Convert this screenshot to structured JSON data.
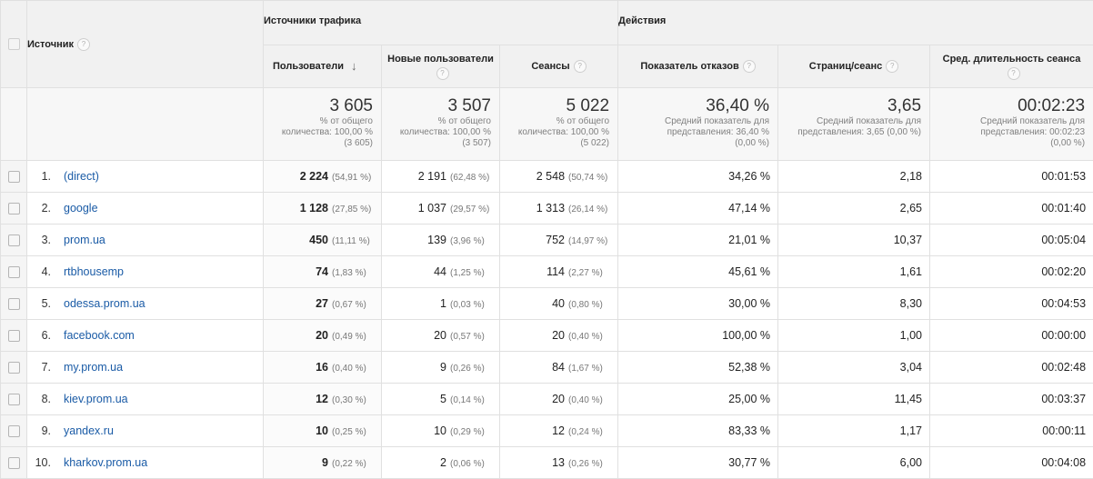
{
  "header": {
    "source_label": "Источник",
    "group_traffic": "Источники трафика",
    "group_actions": "Действия",
    "col_users": "Пользователи",
    "col_new_users": "Новые пользователи",
    "col_sessions": "Сеансы",
    "col_bounce": "Показатель отказов",
    "col_pages": "Страниц/сеанс",
    "col_duration": "Сред. длительность сеанса",
    "help_glyph": "?",
    "sort_glyph": "↓"
  },
  "totals": {
    "users": {
      "value": "3 605",
      "l1": "% от общего",
      "l2": "количества: 100,00 %",
      "l3": "(3 605)"
    },
    "new_users": {
      "value": "3 507",
      "l1": "% от общего",
      "l2": "количества: 100,00 %",
      "l3": "(3 507)"
    },
    "sessions": {
      "value": "5 022",
      "l1": "% от общего",
      "l2": "количества: 100,00 %",
      "l3": "(5 022)"
    },
    "bounce": {
      "value": "36,40 %",
      "l1": "Средний показатель для",
      "l2": "представления: 36,40 %",
      "l3": "(0,00 %)"
    },
    "pages": {
      "value": "3,65",
      "l1": "Средний показатель для",
      "l2": "представления: 3,65 (0,00 %)",
      "l3": ""
    },
    "duration": {
      "value": "00:02:23",
      "l1": "Средний показатель для",
      "l2": "представления: 00:02:23",
      "l3": "(0,00 %)"
    }
  },
  "rows": [
    {
      "idx": "1.",
      "source": "(direct)",
      "users": "2 224",
      "users_pct": "(54,91 %)",
      "new_users": "2 191",
      "new_users_pct": "(62,48 %)",
      "sessions": "2 548",
      "sessions_pct": "(50,74 %)",
      "bounce": "34,26 %",
      "pages": "2,18",
      "duration": "00:01:53"
    },
    {
      "idx": "2.",
      "source": "google",
      "users": "1 128",
      "users_pct": "(27,85 %)",
      "new_users": "1 037",
      "new_users_pct": "(29,57 %)",
      "sessions": "1 313",
      "sessions_pct": "(26,14 %)",
      "bounce": "47,14 %",
      "pages": "2,65",
      "duration": "00:01:40"
    },
    {
      "idx": "3.",
      "source": "prom.ua",
      "users": "450",
      "users_pct": "(11,11 %)",
      "new_users": "139",
      "new_users_pct": "(3,96 %)",
      "sessions": "752",
      "sessions_pct": "(14,97 %)",
      "bounce": "21,01 %",
      "pages": "10,37",
      "duration": "00:05:04"
    },
    {
      "idx": "4.",
      "source": "rtbhousemp",
      "users": "74",
      "users_pct": "(1,83 %)",
      "new_users": "44",
      "new_users_pct": "(1,25 %)",
      "sessions": "114",
      "sessions_pct": "(2,27 %)",
      "bounce": "45,61 %",
      "pages": "1,61",
      "duration": "00:02:20"
    },
    {
      "idx": "5.",
      "source": "odessa.prom.ua",
      "users": "27",
      "users_pct": "(0,67 %)",
      "new_users": "1",
      "new_users_pct": "(0,03 %)",
      "sessions": "40",
      "sessions_pct": "(0,80 %)",
      "bounce": "30,00 %",
      "pages": "8,30",
      "duration": "00:04:53"
    },
    {
      "idx": "6.",
      "source": "facebook.com",
      "users": "20",
      "users_pct": "(0,49 %)",
      "new_users": "20",
      "new_users_pct": "(0,57 %)",
      "sessions": "20",
      "sessions_pct": "(0,40 %)",
      "bounce": "100,00 %",
      "pages": "1,00",
      "duration": "00:00:00"
    },
    {
      "idx": "7.",
      "source": "my.prom.ua",
      "users": "16",
      "users_pct": "(0,40 %)",
      "new_users": "9",
      "new_users_pct": "(0,26 %)",
      "sessions": "84",
      "sessions_pct": "(1,67 %)",
      "bounce": "52,38 %",
      "pages": "3,04",
      "duration": "00:02:48"
    },
    {
      "idx": "8.",
      "source": "kiev.prom.ua",
      "users": "12",
      "users_pct": "(0,30 %)",
      "new_users": "5",
      "new_users_pct": "(0,14 %)",
      "sessions": "20",
      "sessions_pct": "(0,40 %)",
      "bounce": "25,00 %",
      "pages": "11,45",
      "duration": "00:03:37"
    },
    {
      "idx": "9.",
      "source": "yandex.ru",
      "users": "10",
      "users_pct": "(0,25 %)",
      "new_users": "10",
      "new_users_pct": "(0,29 %)",
      "sessions": "12",
      "sessions_pct": "(0,24 %)",
      "bounce": "83,33 %",
      "pages": "1,17",
      "duration": "00:00:11"
    },
    {
      "idx": "10.",
      "source": "kharkov.prom.ua",
      "users": "9",
      "users_pct": "(0,22 %)",
      "new_users": "2",
      "new_users_pct": "(0,06 %)",
      "sessions": "13",
      "sessions_pct": "(0,26 %)",
      "bounce": "30,77 %",
      "pages": "6,00",
      "duration": "00:04:08"
    }
  ]
}
